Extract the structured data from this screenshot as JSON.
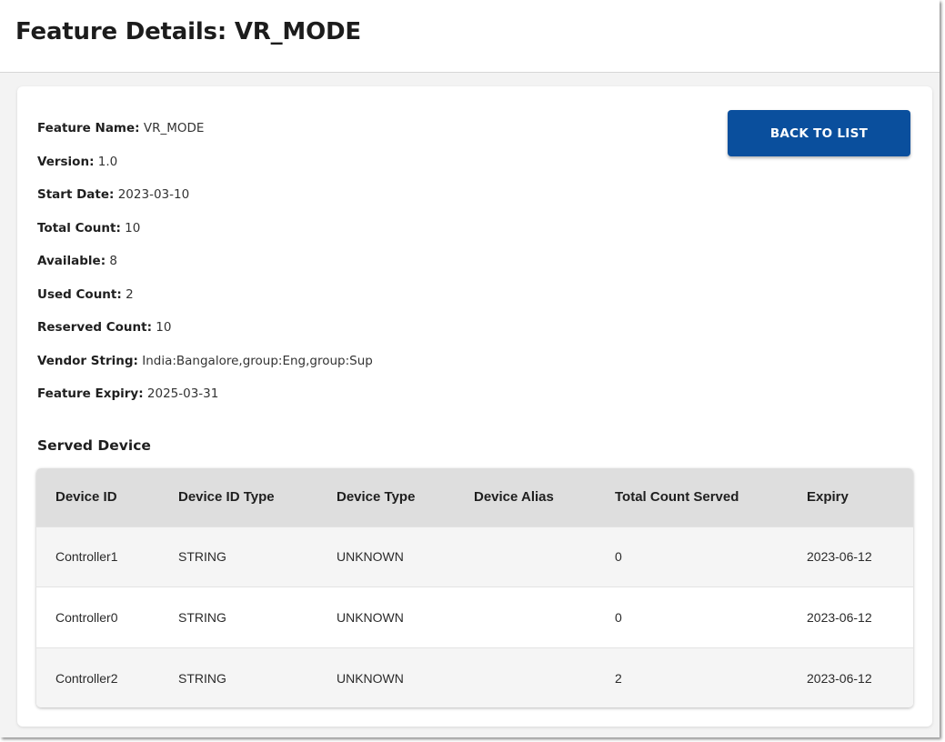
{
  "header": {
    "title": "Feature Details: VR_MODE"
  },
  "details": [
    {
      "key": "Feature Name:",
      "value": "VR_MODE"
    },
    {
      "key": "Version:",
      "value": "1.0"
    },
    {
      "key": "Start Date:",
      "value": "2023-03-10"
    },
    {
      "key": "Total Count:",
      "value": "10"
    },
    {
      "key": "Available:",
      "value": "8"
    },
    {
      "key": "Used Count:",
      "value": "2"
    },
    {
      "key": "Reserved Count:",
      "value": "10"
    },
    {
      "key": "Vendor String:",
      "value": "India:Bangalore,group:Eng,group:Sup"
    },
    {
      "key": "Feature Expiry:",
      "value": "2025-03-31"
    }
  ],
  "actions": {
    "back_label": "BACK TO LIST"
  },
  "served_device": {
    "title": "Served Device",
    "columns": [
      "Device ID",
      "Device ID Type",
      "Device Type",
      "Device Alias",
      "Total Count Served",
      "Expiry"
    ],
    "rows": [
      [
        "Controller1",
        "STRING",
        "UNKNOWN",
        "",
        "0",
        "2023-06-12"
      ],
      [
        "Controller0",
        "STRING",
        "UNKNOWN",
        "",
        "0",
        "2023-06-12"
      ],
      [
        "Controller2",
        "STRING",
        "UNKNOWN",
        "",
        "2",
        "2023-06-12"
      ]
    ]
  },
  "colors": {
    "primary_button": "#0a4f9d",
    "header_row": "#dedede",
    "page_bg": "#f3f3f3"
  }
}
